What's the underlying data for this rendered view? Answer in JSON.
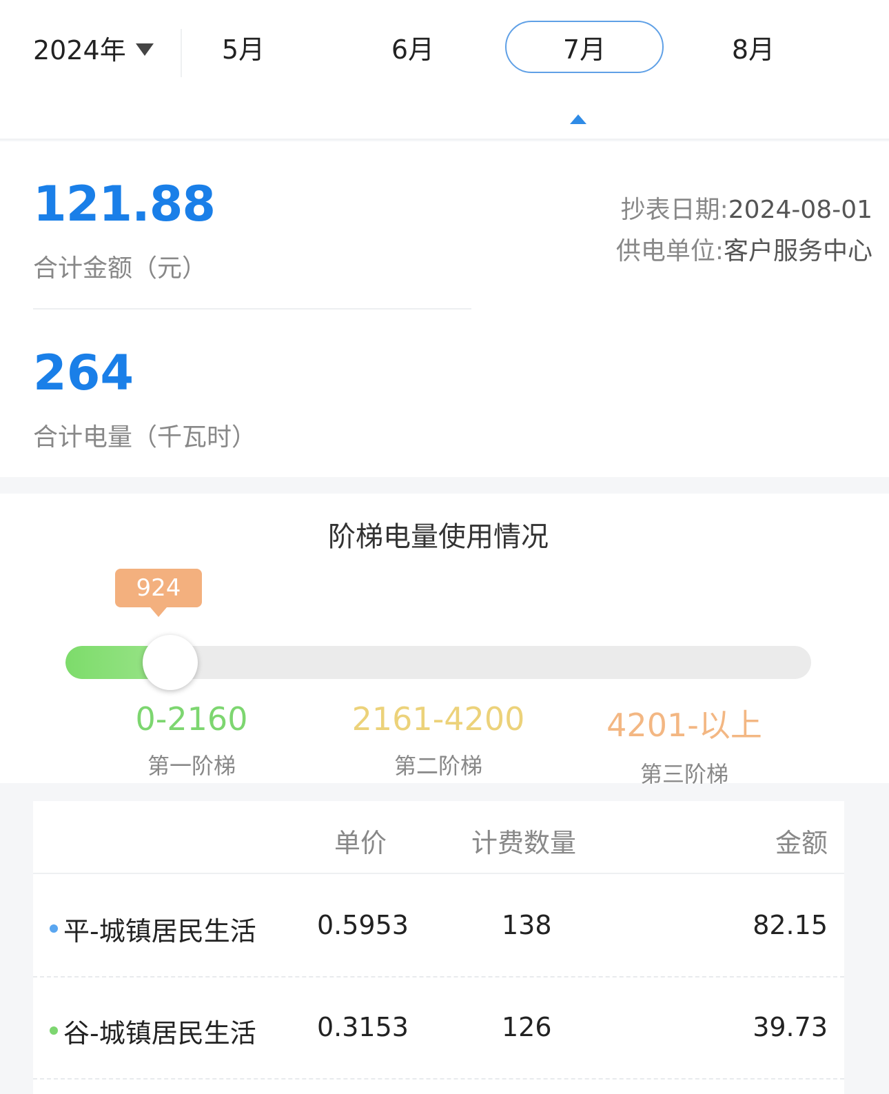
{
  "header": {
    "year_label": "2024年",
    "tabs": [
      {
        "label": "5月",
        "active": false
      },
      {
        "label": "6月",
        "active": false
      },
      {
        "label": "7月",
        "active": true
      },
      {
        "label": "8月",
        "active": false
      }
    ]
  },
  "summary": {
    "total_amount": "121.88",
    "total_amount_label": "合计金额（元）",
    "total_energy": "264",
    "total_energy_label": "合计电量（千瓦时）",
    "reading_date_label": "抄表日期:",
    "reading_date": "2024-08-01",
    "supply_unit_label": "供电单位:",
    "supply_unit": "客户服务中心"
  },
  "tiers": {
    "title": "阶梯电量使用情况",
    "current_usage": "924",
    "progress_fraction": 0.143,
    "items": [
      {
        "range": "0-2160",
        "name": "第一阶梯",
        "color": "#7dd670"
      },
      {
        "range": "2161-4200",
        "name": "第二阶梯",
        "color": "#ecd27a"
      },
      {
        "range": "4201-以上",
        "name": "第三阶梯",
        "color": "#f3b783"
      }
    ]
  },
  "table": {
    "headers": {
      "price": "单价",
      "quantity": "计费数量",
      "amount": "金额"
    },
    "rows": [
      {
        "name": "平-城镇居民生活",
        "price": "0.5953",
        "quantity": "138",
        "amount": "82.15",
        "dot_color": "#5aa6f0"
      },
      {
        "name": "谷-城镇居民生活",
        "price": "0.3153",
        "quantity": "126",
        "amount": "39.73",
        "dot_color": "#7dd670"
      }
    ]
  }
}
